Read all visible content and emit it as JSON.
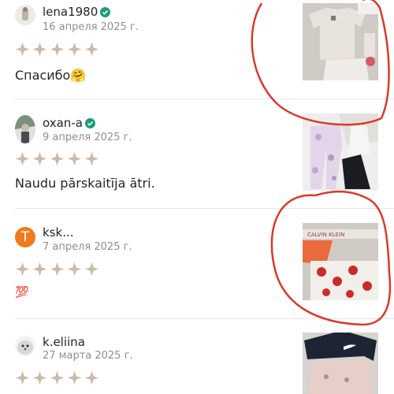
{
  "reviews": [
    {
      "username": "lena1980",
      "verified": true,
      "date": "16 апреля 2025 г.",
      "rating": 5,
      "comment": "Спасибо🤗",
      "avatar_icon": "photo-avatar-icon",
      "photo_icon": "clothing-photo-icon"
    },
    {
      "username": "oxan-a",
      "verified": true,
      "date": "9 апреля 2025 г.",
      "rating": 5,
      "comment": "Naudu pārskaitīja ātri.",
      "avatar_icon": "photo-avatar-icon",
      "photo_icon": "clothing-photo-icon"
    },
    {
      "username": "ksk...",
      "verified": false,
      "avatar_letter": "T",
      "date": "7 апреля 2025 г.",
      "rating": 5,
      "comment": "💯",
      "photo_icon": "underwear-photo-icon"
    },
    {
      "username": "k.eliina",
      "verified": false,
      "date": "27 марта 2025 г.",
      "rating": 5,
      "comment": "",
      "avatar_icon": "seal-avatar-icon",
      "photo_icon": "jacket-photo-icon"
    }
  ],
  "colors": {
    "star": "#c9bba8",
    "verified": "#1a9e75",
    "avatar_letter_bg": "#f07a1e",
    "annotation_red": "#d93a2b"
  }
}
